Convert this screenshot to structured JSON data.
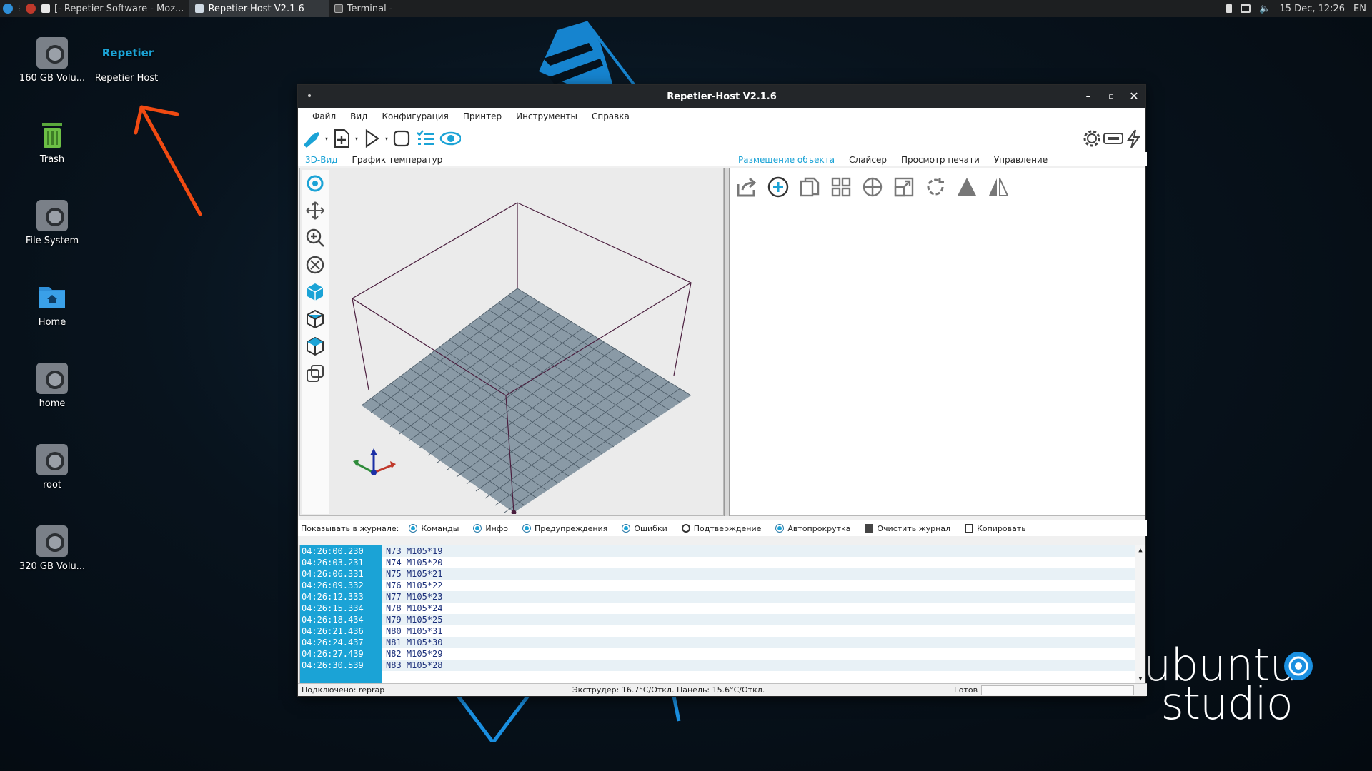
{
  "taskbar": {
    "tasks": [
      {
        "label": "[- Repetier Software - Moz...",
        "active": false
      },
      {
        "label": "Repetier-Host V2.1.6",
        "active": true
      },
      {
        "label": "Terminal -",
        "active": false
      }
    ],
    "clock": "15 Dec, 12:26",
    "lang": "EN"
  },
  "desktop": {
    "icons": [
      {
        "label": "160 GB Volu...",
        "icon": "drive-icon"
      },
      {
        "label": "Repetier Host",
        "icon": "repetier-icon"
      },
      {
        "label": "Trash",
        "icon": "trash-icon"
      },
      {
        "label": "File System",
        "icon": "drive-icon"
      },
      {
        "label": "Home",
        "icon": "home-folder-icon"
      },
      {
        "label": "home",
        "icon": "drive-icon"
      },
      {
        "label": "root",
        "icon": "drive-icon"
      },
      {
        "label": "320 GB Volu...",
        "icon": "drive-icon"
      }
    ],
    "repetier_badge": "Repetier",
    "brand_line1": "ubuntu",
    "brand_line2": "studio"
  },
  "window": {
    "title": "Repetier-Host V2.1.6",
    "menu": [
      "Файл",
      "Вид",
      "Конфигурация",
      "Принтер",
      "Инструменты",
      "Справка"
    ],
    "left_tabs": [
      "3D-Вид",
      "График температур"
    ],
    "right_tabs": [
      "Размещение объекта",
      "Слайсер",
      "Просмотр печати",
      "Управление"
    ],
    "log_filter": {
      "label": "Показывать в журнале:",
      "options": [
        {
          "label": "Команды",
          "checked": true
        },
        {
          "label": "Инфо",
          "checked": true
        },
        {
          "label": "Предупреждения",
          "checked": true
        },
        {
          "label": "Ошибки",
          "checked": true
        },
        {
          "label": "Подтверждение",
          "checked": false
        },
        {
          "label": "Автопрокрутка",
          "checked": true
        }
      ],
      "clear_label": "Очистить журнал",
      "copy_label": "Копировать"
    },
    "log": [
      {
        "time": "04:26:00.230",
        "msg": "N73 M105*19"
      },
      {
        "time": "04:26:03.231",
        "msg": "N74 M105*20"
      },
      {
        "time": "04:26:06.331",
        "msg": "N75 M105*21"
      },
      {
        "time": "04:26:09.332",
        "msg": "N76 M105*22"
      },
      {
        "time": "04:26:12.333",
        "msg": "N77 M105*23"
      },
      {
        "time": "04:26:15.334",
        "msg": "N78 M105*24"
      },
      {
        "time": "04:26:18.434",
        "msg": "N79 M105*25"
      },
      {
        "time": "04:26:21.436",
        "msg": "N80 M105*31"
      },
      {
        "time": "04:26:24.437",
        "msg": "N81 M105*30"
      },
      {
        "time": "04:26:27.439",
        "msg": "N82 M105*29"
      },
      {
        "time": "04:26:30.539",
        "msg": "N83 M105*28"
      }
    ],
    "status": {
      "connection": "Подключено: reprap",
      "temps": "Экструдер: 16.7°C/Откл. Панель: 15.6°C/Откл.",
      "state": "Готов"
    }
  },
  "colors": {
    "accent": "#1ba3d6",
    "log_text": "#1b2f7a",
    "bed": "#8a9aa6"
  }
}
